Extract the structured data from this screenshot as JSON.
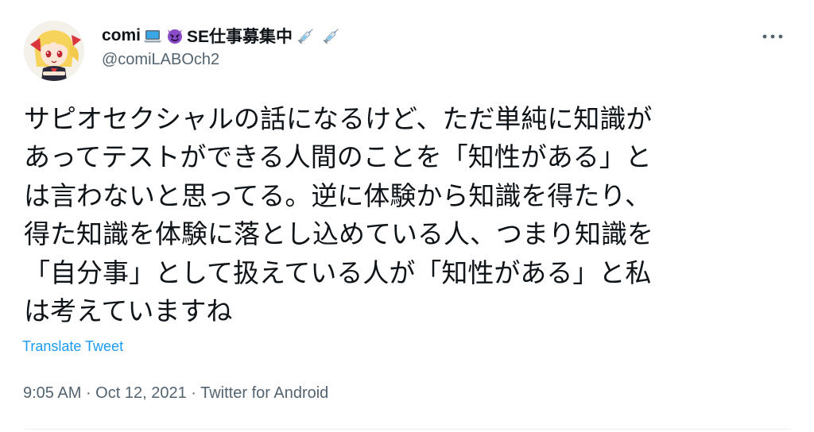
{
  "author": {
    "name": "comi",
    "name_suffix": "SE仕事募集中",
    "emojis": [
      "laptop-icon",
      "smiling-devil-icon",
      "syringe-icon",
      "syringe-icon"
    ],
    "handle": "@comiLABOch2"
  },
  "more_label": "More",
  "tweet": {
    "lines": [
      "サピオセクシャルの話になるけど、ただ単純に知識が",
      "あってテストができる人間のことを「知性がある」と",
      "は言わないと思ってる。逆に体験から知識を得たり、",
      "得た知識を体験に落とし込めている人、つまり知識を",
      "「自分事」として扱えている人が「知性がある」と私",
      "は考えていますね"
    ],
    "translate_label": "Translate Tweet"
  },
  "meta": {
    "time": "9:05 AM",
    "date": "Oct 12, 2021",
    "source": "Twitter for Android",
    "separator": " · "
  },
  "colors": {
    "text": "#0f1419",
    "secondary": "#536471",
    "link": "#1d9bf0"
  }
}
